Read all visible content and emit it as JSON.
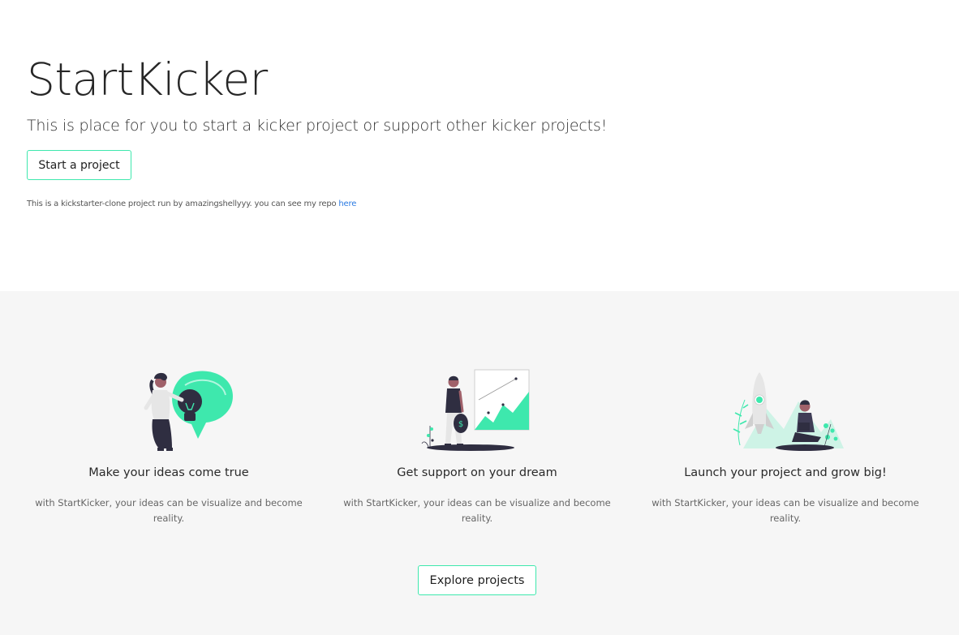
{
  "hero": {
    "title": "StartKicker",
    "subtitle": "This is place for you to start a kicker project or support other kicker projects!",
    "start_button": "Start a project",
    "credit_text": "This is a kickstarter-clone project run by amazingshellyyy. you can see my repo",
    "credit_link": "here"
  },
  "features": [
    {
      "illustration": "idea-lightbulb-illustration",
      "title": "Make your ideas come true",
      "description": "with StartKicker, your ideas can be visualize and become reality."
    },
    {
      "illustration": "growth-chart-illustration",
      "title": "Get support on your dream",
      "description": "with StartKicker, your ideas can be visualize and become reality."
    },
    {
      "illustration": "rocket-launch-illustration",
      "title": "Launch your project and grow big!",
      "description": "with StartKicker, your ideas can be visualize and become reality."
    }
  ],
  "explore_button": "Explore projects",
  "colors": {
    "accent": "#3ee8ad",
    "link": "#2a7ae2",
    "section_bg": "#f6f6f6",
    "dark_figure": "#2f2e41"
  }
}
